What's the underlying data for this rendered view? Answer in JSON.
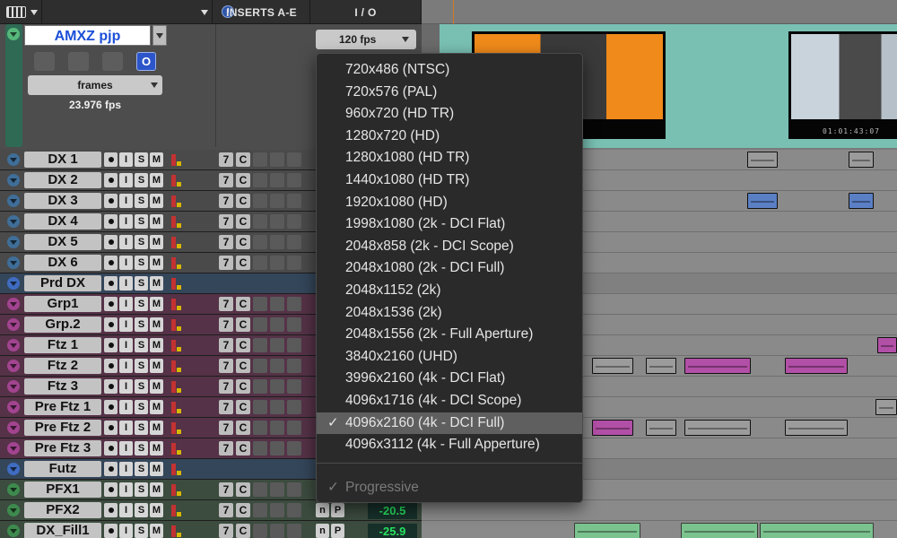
{
  "headers": {
    "inserts": "INSERTS A-E",
    "io": "I / O"
  },
  "video_track": {
    "name": "AMXZ pjp",
    "online_button": "O",
    "timebase_select": "frames",
    "frame_rate": "23.976 fps",
    "io_rate_select": "120 fps"
  },
  "tracks": [
    {
      "name": "DX 1",
      "color": "#3f6e98",
      "fill": "#4a4a4a",
      "inserts": true
    },
    {
      "name": "DX 2",
      "color": "#3f6e98",
      "fill": "#4a4a4a",
      "inserts": true
    },
    {
      "name": "DX 3",
      "color": "#3f6e98",
      "fill": "#4a4a4a",
      "inserts": true
    },
    {
      "name": "DX 4",
      "color": "#3f6e98",
      "fill": "#4a4a4a",
      "inserts": true
    },
    {
      "name": "DX 5",
      "color": "#3f6e98",
      "fill": "#4a4a4a",
      "inserts": true
    },
    {
      "name": "DX 6",
      "color": "#3f6e98",
      "fill": "#4a4a4a",
      "inserts": true
    },
    {
      "name": "Prd DX",
      "color": "#3f6cc0",
      "fill": "#34465a",
      "inserts": false
    },
    {
      "name": "Grp1",
      "color": "#a2448f",
      "fill": "#553247",
      "inserts": true
    },
    {
      "name": "Grp.2",
      "color": "#a2448f",
      "fill": "#553247",
      "inserts": true
    },
    {
      "name": "Ftz 1",
      "color": "#a2448f",
      "fill": "#553247",
      "inserts": true
    },
    {
      "name": "Ftz 2",
      "color": "#a2448f",
      "fill": "#553247",
      "inserts": true
    },
    {
      "name": "Ftz 3",
      "color": "#a2448f",
      "fill": "#553247",
      "inserts": true
    },
    {
      "name": "Pre  Ftz 1",
      "color": "#a2448f",
      "fill": "#553247",
      "inserts": true
    },
    {
      "name": "Pre  Ftz 2",
      "color": "#a2448f",
      "fill": "#553247",
      "inserts": true
    },
    {
      "name": "Pre  Ftz 3",
      "color": "#a2448f",
      "fill": "#553247",
      "inserts": true
    },
    {
      "name": "Futz",
      "color": "#3f6cc0",
      "fill": "#34465a",
      "inserts": false
    },
    {
      "name": "PFX1",
      "color": "#3e8a4e",
      "fill": "#3c4c3f",
      "inserts": true
    },
    {
      "name": "PFX2",
      "color": "#3e8a4e",
      "fill": "#3c4c3f",
      "inserts": true,
      "io_value": "-20.5"
    },
    {
      "name": "DX_Fill1",
      "color": "#3e8a4e",
      "fill": "#3c4c3f",
      "inserts": true,
      "io_value": "-25.9"
    }
  ],
  "track_buttons": [
    "I",
    "S",
    "M"
  ],
  "insert_labels": [
    "7",
    "C"
  ],
  "io_small_buttons": [
    "n",
    "P"
  ],
  "menu": {
    "items": [
      "720x486 (NTSC)",
      "720x576 (PAL)",
      "960x720 (HD TR)",
      "1280x720 (HD)",
      "1280x1080 (HD TR)",
      "1440x1080 (HD TR)",
      "1920x1080 (HD)",
      "1998x1080 (2k - DCI Flat)",
      "2048x858 (2k - DCI Scope)",
      "2048x1080 (2k - DCI Full)",
      "2048x1152 (2k)",
      "2048x1536 (2k)",
      "2048x1556 (2k - Full Aperture)",
      "3840x2160 (UHD)",
      "3996x2160 (4k - DCI Flat)",
      "4096x1716 (4k - DCI Scope)",
      "4096x2160 (4k - DCI Full)",
      "4096x3112 (4k - Full Apperture)"
    ],
    "selected_index": 16,
    "checkmark": "✓",
    "progressive_label": "Progressive"
  },
  "video_timecode": "01:01:43:07"
}
